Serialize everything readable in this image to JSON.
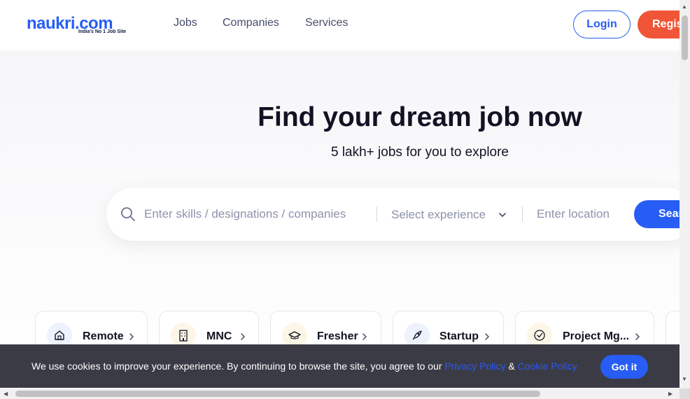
{
  "header": {
    "logo_text": "naukri.com",
    "logo_tagline": "India's No 1 Job Site",
    "nav": [
      "Jobs",
      "Companies",
      "Services"
    ],
    "login_label": "Login",
    "register_label": "Register"
  },
  "hero": {
    "title": "Find your dream job now",
    "subtitle": "5 lakh+ jobs for you to explore"
  },
  "search": {
    "skills_placeholder": "Enter skills / designations / companies",
    "experience_placeholder": "Select experience",
    "location_placeholder": "Enter location",
    "button_label": "Search"
  },
  "categories": [
    {
      "label": "Remote",
      "icon": "home-icon",
      "color": "#eef2fd"
    },
    {
      "label": "MNC",
      "icon": "building-icon",
      "color": "#fdf6e6"
    },
    {
      "label": "Fresher",
      "icon": "graduation-cap-icon",
      "color": "#fdf6e6"
    },
    {
      "label": "Startup",
      "icon": "rocket-icon",
      "color": "#eef2fd"
    },
    {
      "label": "Project Mg...",
      "icon": "check-circle-icon",
      "color": "#fdf6e6"
    }
  ],
  "cookie": {
    "text": "We use cookies to improve your experience. By continuing to browse the site, you agree to our ",
    "privacy_label": "Privacy Policy",
    "amp": " & ",
    "cookie_label": "Cookie Policy",
    "button_label": "Got it"
  },
  "colors": {
    "brand_blue": "#275df5",
    "register_orange": "#f05537",
    "text_dark": "#121224"
  }
}
